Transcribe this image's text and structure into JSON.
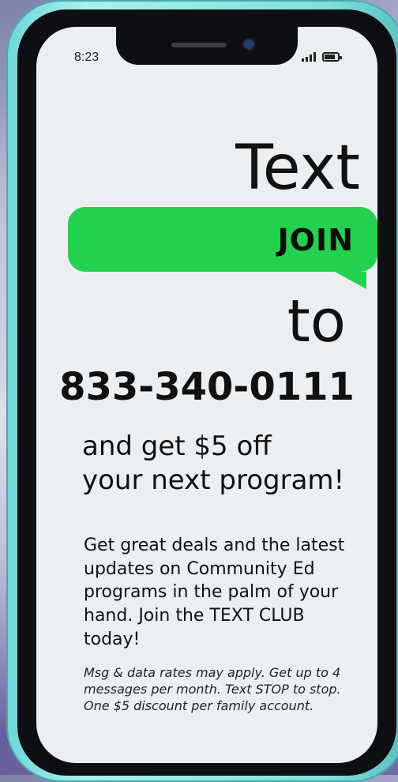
{
  "status_bar": {
    "time": "8:23",
    "icons": [
      "signal-icon",
      "battery-icon"
    ]
  },
  "hero": {
    "text_word": "Text",
    "bubble_word": "JOIN",
    "to_word": "to",
    "phone_number": "833-340-0111"
  },
  "offer": {
    "line1": "and get $5 off",
    "line2": "your next program!"
  },
  "description": {
    "line1": "Get great deals and the latest",
    "line2": "updates on Community Ed",
    "line3": "programs in the palm of your",
    "line4": "hand. Join the TEXT CLUB today!"
  },
  "fineprint": {
    "line1": "Msg & data rates may apply. Get up to 4",
    "line2": "messages per month. Text STOP to stop.",
    "line3": "One $5 discount per family account."
  },
  "colors": {
    "bubble_green": "#22d24f",
    "phone_case": "#7fe0dc",
    "screen_bg": "#eceff1"
  }
}
